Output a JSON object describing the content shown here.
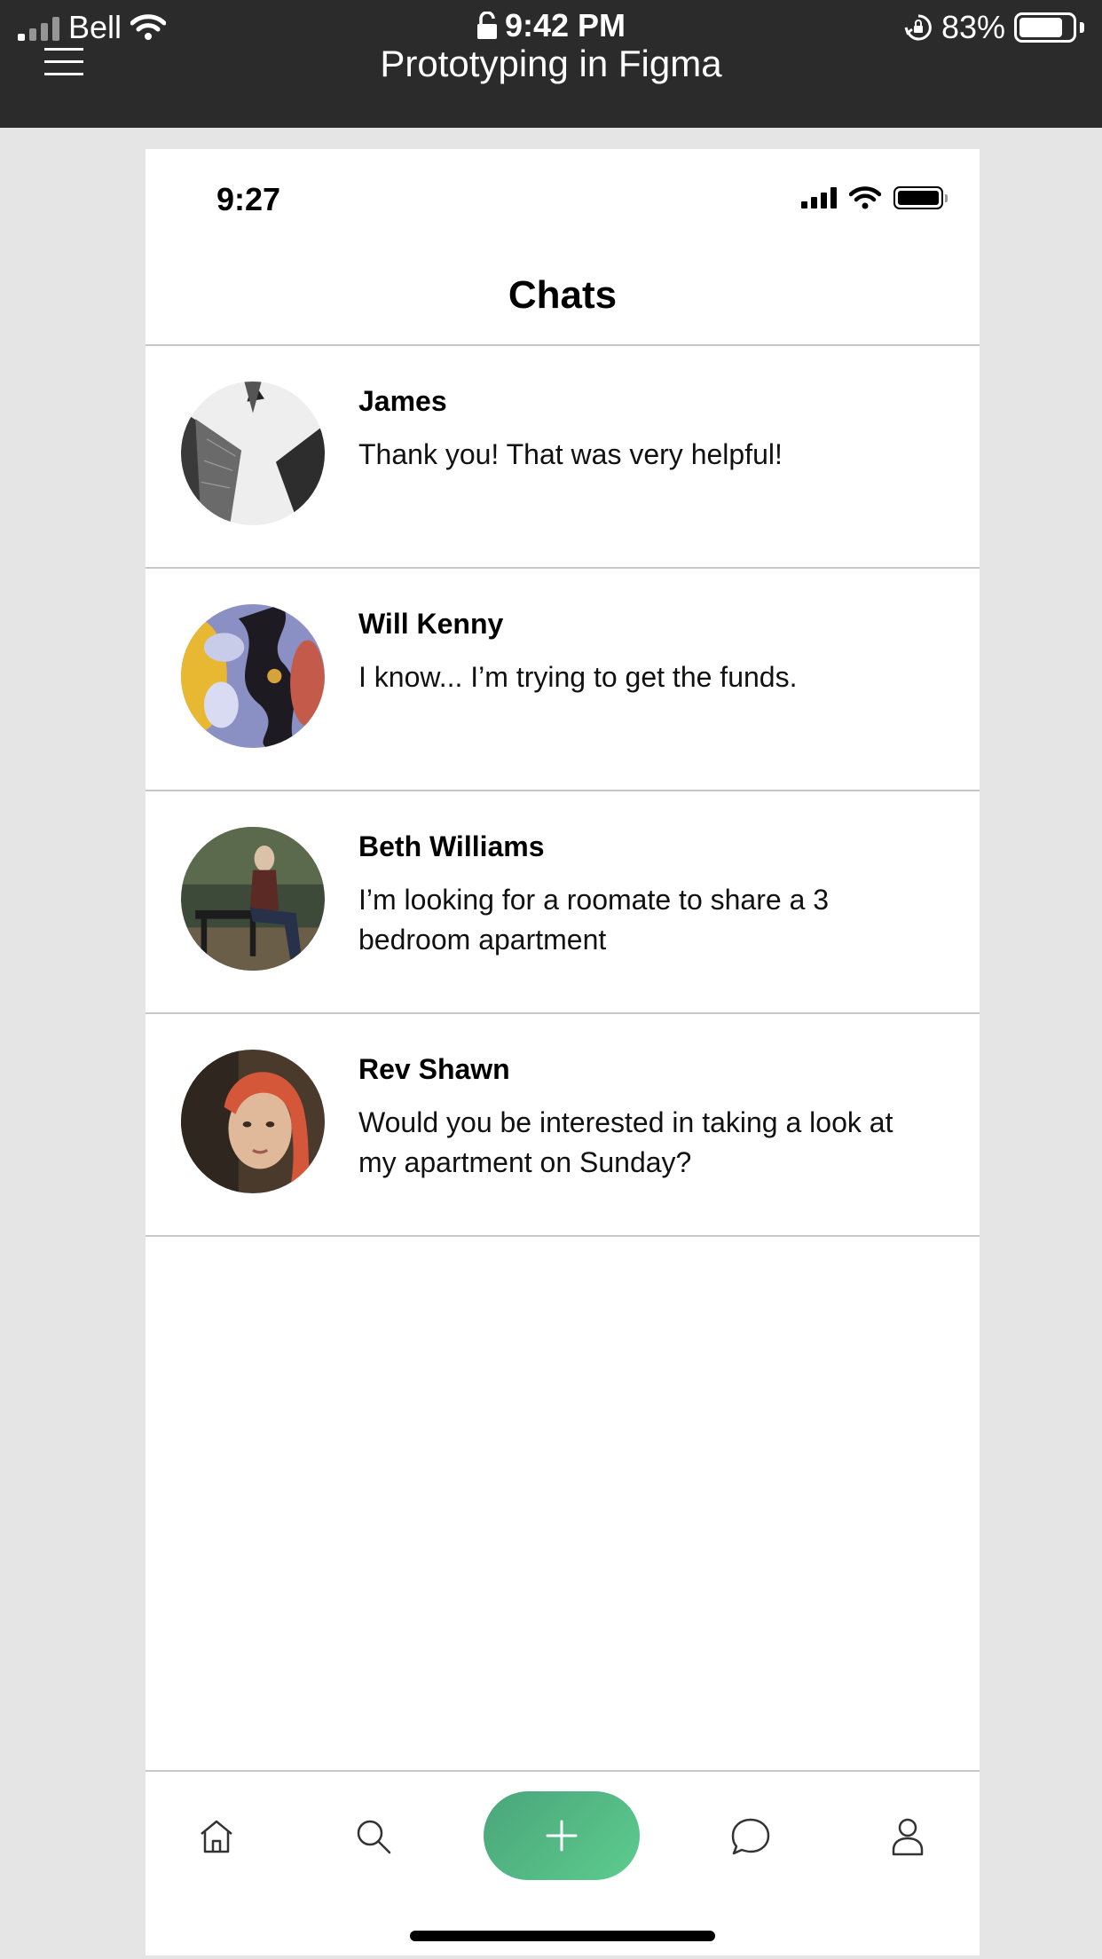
{
  "system_status": {
    "carrier": "Bell",
    "time": "9:42 PM",
    "battery": "83%",
    "battery_level": 0.83
  },
  "app_header": {
    "title": "Prototyping in Figma"
  },
  "prototype": {
    "status_time": "9:27",
    "screen_title": "Chats",
    "chats": [
      {
        "name": "James",
        "message": "Thank you! That was very helpful!",
        "avatar": "skyscrapers-avatar"
      },
      {
        "name": "Will Kenny",
        "message": "I know... I’m trying to get the funds.",
        "avatar": "abstract-paint-avatar"
      },
      {
        "name": "Beth Williams",
        "message": "I’m looking for a roomate to share a 3 bedroom apartment",
        "avatar": "woman-on-bench-avatar"
      },
      {
        "name": "Rev Shawn",
        "message": "Would you be interested in taking a look at my apartment on Sunday?",
        "avatar": "red-hair-woman-avatar"
      }
    ],
    "tabs": [
      "home-icon",
      "search-icon",
      "plus-icon",
      "chat-bubble-icon",
      "profile-icon"
    ],
    "accent_color": "#5dcc8e"
  }
}
